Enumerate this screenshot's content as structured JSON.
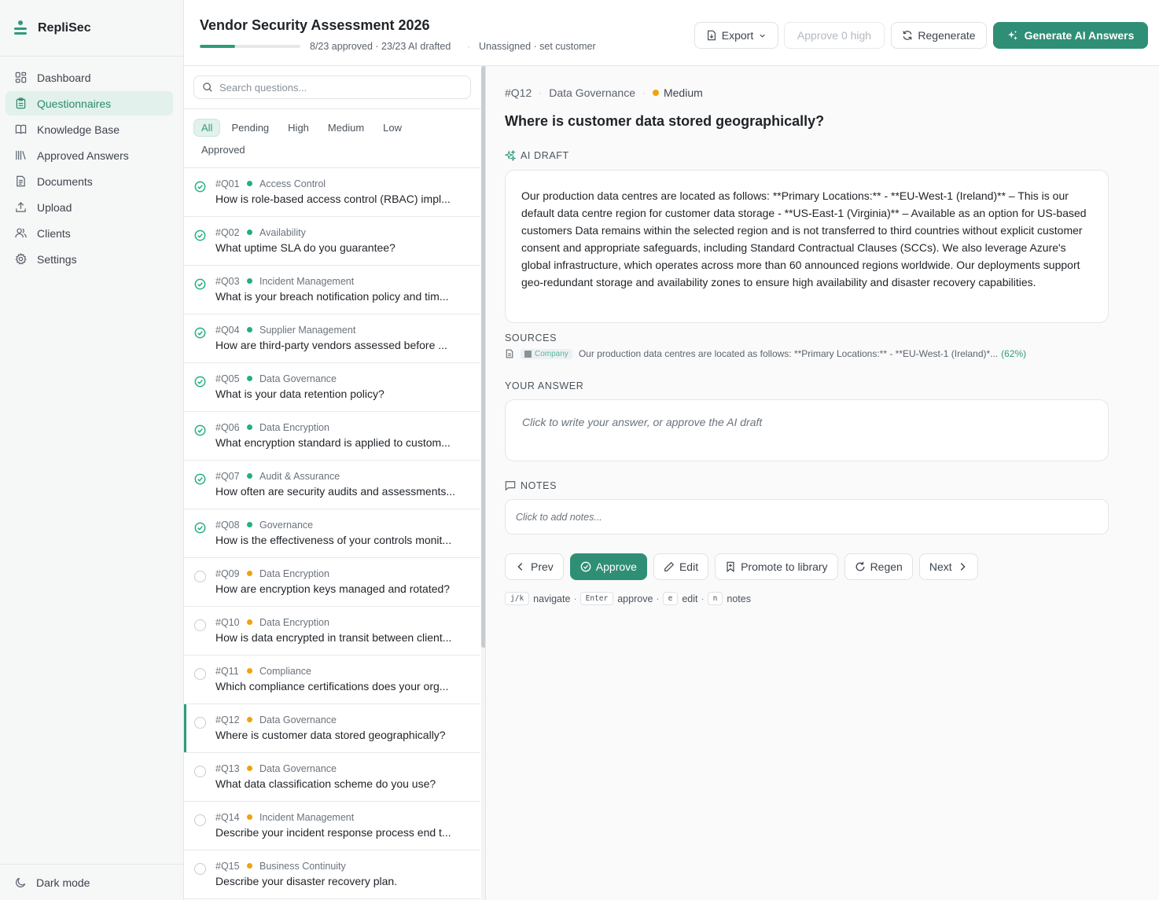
{
  "app": {
    "name": "RepliSec"
  },
  "sidebar": {
    "items": [
      {
        "label": "Dashboard",
        "icon": "dashboard-icon"
      },
      {
        "label": "Questionnaires",
        "icon": "clipboard-icon",
        "active": true
      },
      {
        "label": "Knowledge Base",
        "icon": "book-icon"
      },
      {
        "label": "Approved Answers",
        "icon": "library-icon"
      },
      {
        "label": "Documents",
        "icon": "document-icon"
      },
      {
        "label": "Upload",
        "icon": "upload-icon"
      },
      {
        "label": "Clients",
        "icon": "users-icon"
      },
      {
        "label": "Settings",
        "icon": "gear-icon"
      }
    ],
    "footer": {
      "label": "Dark mode",
      "icon": "moon-icon"
    }
  },
  "header": {
    "title": "Vendor Security Assessment 2026",
    "progress": 0.35,
    "stats": "8/23 approved · 23/23 AI drafted",
    "separator": "·",
    "assign": "Unassigned · set customer",
    "buttons": {
      "export": "Export",
      "approve_high": "Approve 0 high",
      "regenerate": "Regenerate",
      "generate": "Generate AI Answers"
    }
  },
  "colors": {
    "accent": "#2f8f76",
    "approved_dot": "#22b07d",
    "pending_dot": "#f0a30a"
  },
  "search": {
    "placeholder": "Search questions..."
  },
  "filters": [
    "All",
    "Pending",
    "High",
    "Medium",
    "Low",
    "Approved"
  ],
  "questions": [
    {
      "id": "#Q01",
      "category": "Access Control",
      "text": "How is role-based access control (RBAC) impl...",
      "status": "approved"
    },
    {
      "id": "#Q02",
      "category": "Availability",
      "text": "What uptime SLA do you guarantee?",
      "status": "approved"
    },
    {
      "id": "#Q03",
      "category": "Incident Management",
      "text": "What is your breach notification policy and tim...",
      "status": "approved"
    },
    {
      "id": "#Q04",
      "category": "Supplier Management",
      "text": "How are third-party vendors assessed before ...",
      "status": "approved"
    },
    {
      "id": "#Q05",
      "category": "Data Governance",
      "text": "What is your data retention policy?",
      "status": "approved"
    },
    {
      "id": "#Q06",
      "category": "Data Encryption",
      "text": "What encryption standard is applied to custom...",
      "status": "approved"
    },
    {
      "id": "#Q07",
      "category": "Audit & Assurance",
      "text": "How often are security audits and assessments...",
      "status": "approved"
    },
    {
      "id": "#Q08",
      "category": "Governance",
      "text": "How is the effectiveness of your controls monit...",
      "status": "approved"
    },
    {
      "id": "#Q09",
      "category": "Data Encryption",
      "text": "How are encryption keys managed and rotated?",
      "status": "pending"
    },
    {
      "id": "#Q10",
      "category": "Data Encryption",
      "text": "How is data encrypted in transit between client...",
      "status": "pending"
    },
    {
      "id": "#Q11",
      "category": "Compliance",
      "text": "Which compliance certifications does your org...",
      "status": "pending"
    },
    {
      "id": "#Q12",
      "category": "Data Governance",
      "text": "Where is customer data stored geographically?",
      "status": "pending",
      "selected": true
    },
    {
      "id": "#Q13",
      "category": "Data Governance",
      "text": "What data classification scheme do you use?",
      "status": "pending"
    },
    {
      "id": "#Q14",
      "category": "Incident Management",
      "text": "Describe your incident response process end t...",
      "status": "pending"
    },
    {
      "id": "#Q15",
      "category": "Business Continuity",
      "text": "Describe your disaster recovery plan.",
      "status": "pending"
    }
  ],
  "detail": {
    "id": "#Q12",
    "category": "Data Governance",
    "priority": "Medium",
    "meta_sep": "·",
    "question": "Where is customer data stored geographically?",
    "ai_draft_label": "AI DRAFT",
    "ai_draft": "Our production data centres are located as follows: **Primary Locations:** - **EU-West-1 (Ireland)** – This is our default data centre region for customer data storage - **US-East-1 (Virginia)** – Available as an option for US-based customers Data remains within the selected region and is not transferred to third countries without explicit customer consent and appropriate safeguards, including Standard Contractual Clauses (SCCs). We also leverage Azure's global infrastructure, which operates across more than 60 announced regions worldwide. Our deployments support geo-redundant storage and availability zones to ensure high availability and disaster recovery capabilities.",
    "sources_label": "SOURCES",
    "source_tag": "Company",
    "source_text": "Our production data centres are located as follows: **Primary Locations:** - **EU-West-1 (Ireland)*...",
    "source_pct": "(62%)",
    "your_answer_label": "YOUR ANSWER",
    "your_answer_placeholder": "Click to write your answer, or approve the AI draft",
    "notes_label": "NOTES",
    "notes_placeholder": "Click to add notes...",
    "actions": {
      "prev": "Prev",
      "approve": "Approve",
      "edit": "Edit",
      "promote": "Promote to library",
      "regen": "Regen",
      "next": "Next"
    },
    "shortcuts": [
      {
        "key": "j/k",
        "label": "navigate"
      },
      {
        "key": "Enter",
        "label": "approve"
      },
      {
        "key": "e",
        "label": "edit"
      },
      {
        "key": "n",
        "label": "notes"
      }
    ],
    "shortcut_sep": "·"
  }
}
